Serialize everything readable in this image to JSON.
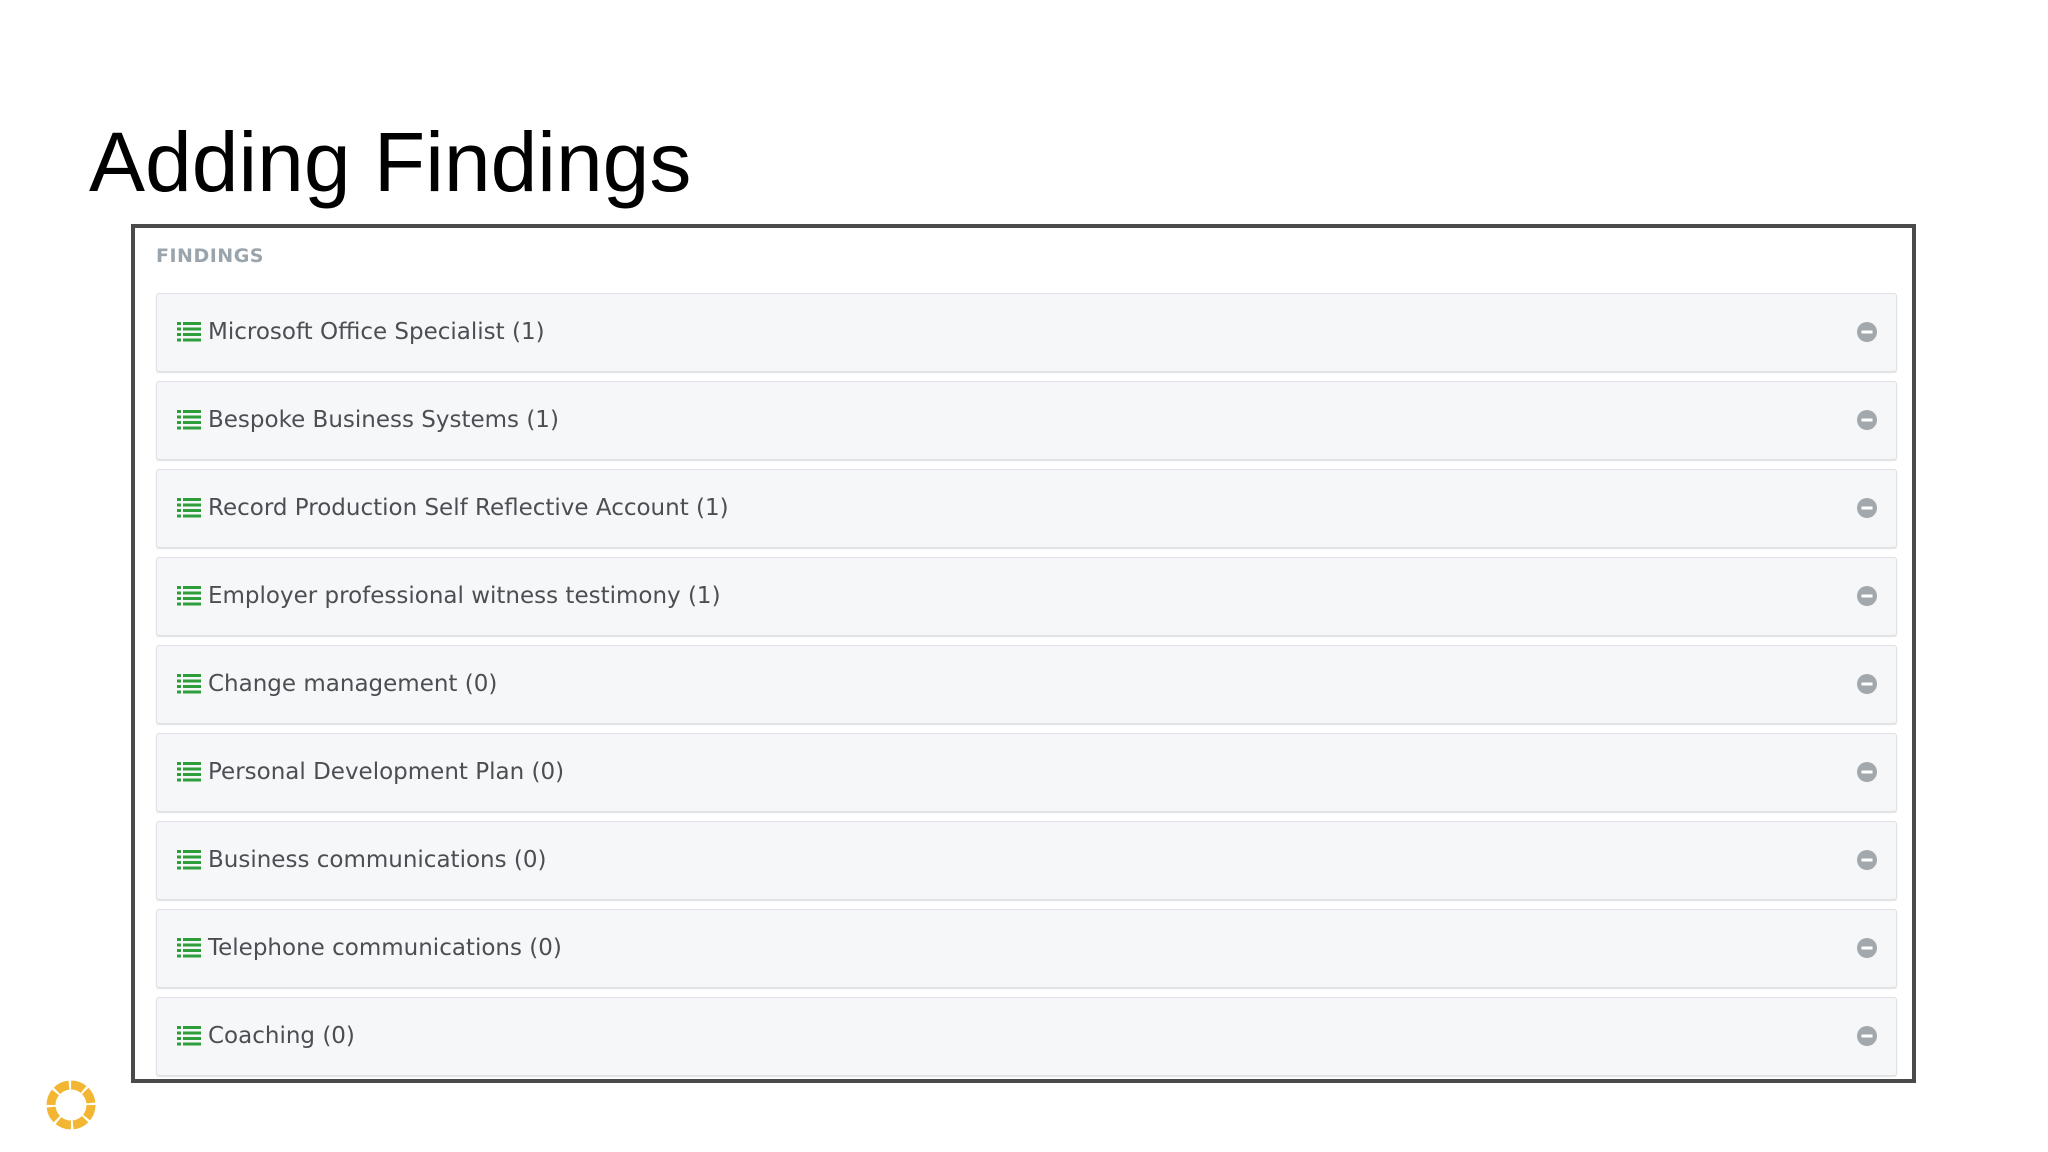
{
  "slide": {
    "title": "Adding Findings"
  },
  "panel": {
    "section_label": "FINDINGS",
    "items": [
      {
        "label": "Microsoft Office Specialist (1)",
        "icon": "list-icon",
        "action_icon": "collapse-icon"
      },
      {
        "label": "Bespoke Business Systems (1)",
        "icon": "list-icon",
        "action_icon": "collapse-icon"
      },
      {
        "label": "Record Production Self Reflective Account (1)",
        "icon": "list-icon",
        "action_icon": "collapse-icon"
      },
      {
        "label": "Employer professional witness testimony (1)",
        "icon": "list-icon",
        "action_icon": "collapse-icon"
      },
      {
        "label": "Change management (0)",
        "icon": "list-icon",
        "action_icon": "collapse-icon"
      },
      {
        "label": "Personal Development Plan (0)",
        "icon": "list-icon",
        "action_icon": "collapse-icon"
      },
      {
        "label": "Business communications (0)",
        "icon": "list-icon",
        "action_icon": "collapse-icon"
      },
      {
        "label": "Telephone communications (0)",
        "icon": "list-icon",
        "action_icon": "collapse-icon"
      },
      {
        "label": "Coaching (0)",
        "icon": "list-icon",
        "action_icon": "collapse-icon"
      }
    ]
  },
  "colors": {
    "list_icon": "#2e9e3a",
    "collapse_icon": "#a3a8ad",
    "row_background": "#f6f7f9",
    "label_text": "#4b4f54",
    "section_label": "#9aa4ad",
    "frame_border": "#4a4a4a",
    "logo": "#f2b632"
  }
}
